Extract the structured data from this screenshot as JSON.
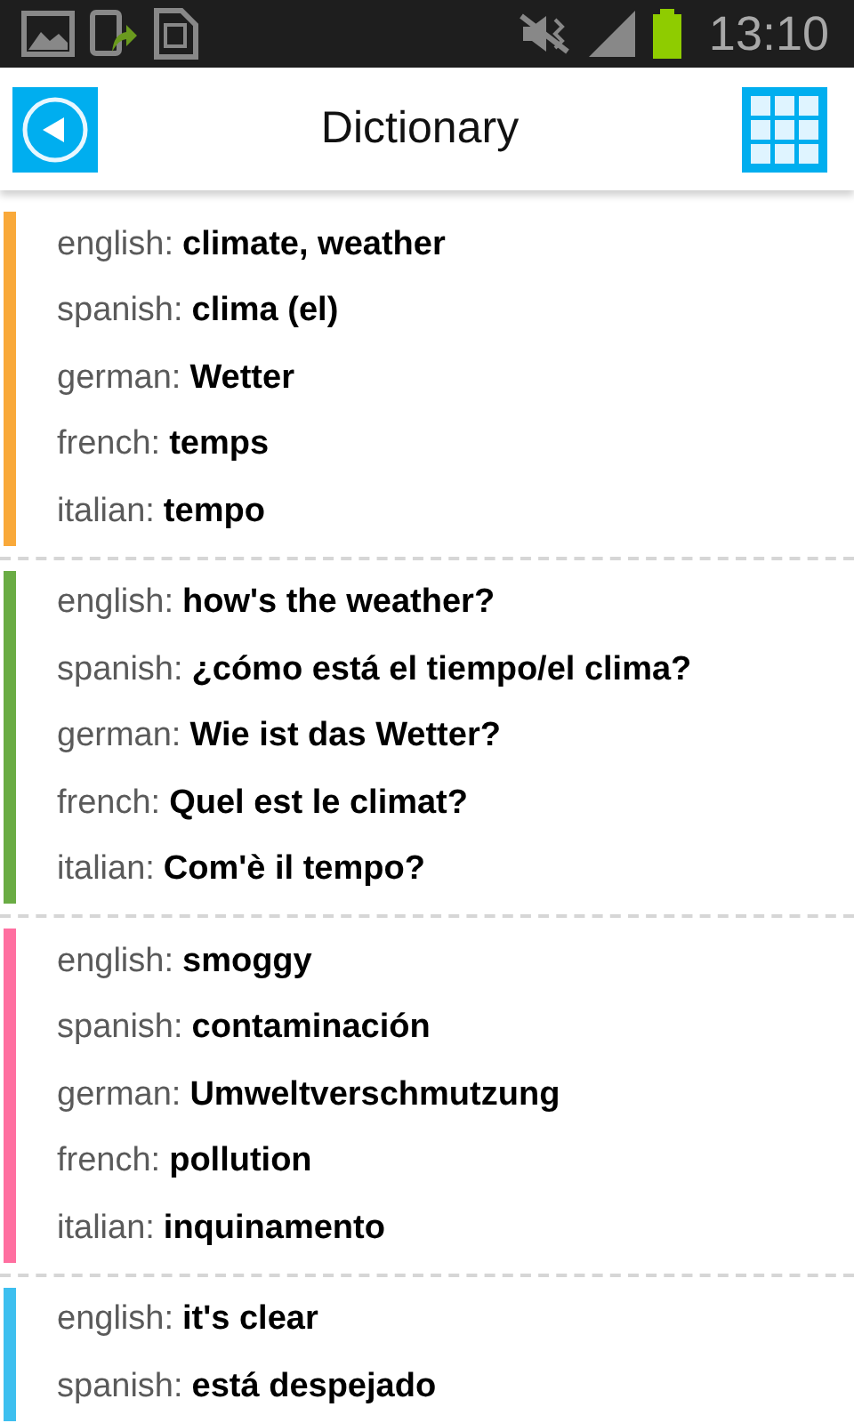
{
  "status_bar": {
    "time": "13:10"
  },
  "header": {
    "title": "Dictionary"
  },
  "entries": [
    {
      "color": "#f9a93a",
      "lines": [
        {
          "language": "english:",
          "term": "climate, weather"
        },
        {
          "language": "spanish:",
          "term": "clima (el)"
        },
        {
          "language": "german:",
          "term": "Wetter"
        },
        {
          "language": "french:",
          "term": "temps"
        },
        {
          "language": "italian:",
          "term": "tempo"
        }
      ]
    },
    {
      "color": "#6aac44",
      "lines": [
        {
          "language": "english:",
          "term": "how's the weather?"
        },
        {
          "language": "spanish:",
          "term": "¿cómo está el tiempo/el clima?"
        },
        {
          "language": "german:",
          "term": "Wie ist das Wetter?"
        },
        {
          "language": "french:",
          "term": "Quel est le climat?"
        },
        {
          "language": "italian:",
          "term": "Com'è il tempo?"
        }
      ]
    },
    {
      "color": "#ff6fa0",
      "lines": [
        {
          "language": "english:",
          "term": "smoggy"
        },
        {
          "language": "spanish:",
          "term": "contaminación"
        },
        {
          "language": "german:",
          "term": "Umweltverschmutzung"
        },
        {
          "language": "french:",
          "term": "pollution"
        },
        {
          "language": "italian:",
          "term": "inquinamento"
        }
      ]
    },
    {
      "color": "#3dbfef",
      "lines": [
        {
          "language": "english:",
          "term": "it's clear"
        },
        {
          "language": "spanish:",
          "term": "está despejado"
        }
      ]
    }
  ]
}
